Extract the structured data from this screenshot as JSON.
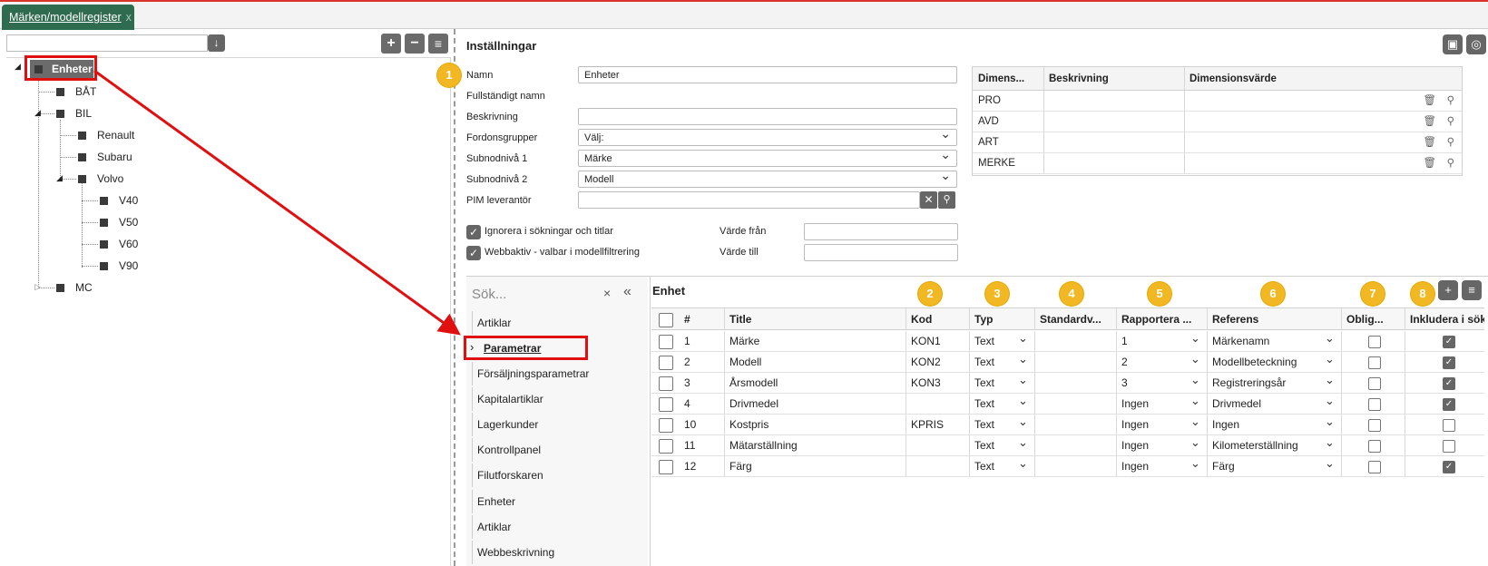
{
  "tab": {
    "label": "Märken/modellregister",
    "close": "x"
  },
  "tree": {
    "search_placeholder": "",
    "root": "Enheter",
    "nodes": [
      "BÅT",
      "BIL",
      "Renault",
      "Subaru",
      "Volvo",
      "V40",
      "V50",
      "V60",
      "V90",
      "MC"
    ]
  },
  "settings": {
    "title": "Inställningar",
    "fields": {
      "namn_label": "Namn",
      "namn_value": "Enheter",
      "fullst_label": "Fullständigt namn",
      "beskr_label": "Beskrivning",
      "beskr_value": "",
      "fordon_label": "Fordonsgrupper",
      "fordon_value": "Välj:",
      "sub1_label": "Subnodnivå 1",
      "sub1_value": "Märke",
      "sub2_label": "Subnodnivå 2",
      "sub2_value": "Modell",
      "pim_label": "PIM leverantör",
      "pim_value": ""
    },
    "checks": {
      "ignore_label": "Ignorera i sökningar och titlar",
      "web_label": "Webbaktiv - valbar i modellfiltrering"
    },
    "range": {
      "from_label": "Värde från",
      "to_label": "Värde till",
      "from_value": "",
      "to_value": ""
    }
  },
  "dim_table": {
    "headers": [
      "Dimens...",
      "Beskrivning",
      "Dimensionsvärde"
    ],
    "rows": [
      "PRO",
      "AVD",
      "ART",
      "MERKE"
    ]
  },
  "side": {
    "search_placeholder": "Sök...",
    "items": [
      "Artiklar",
      "Parametrar",
      "Försäljningsparametrar",
      "Kapitalartiklar",
      "Lagerkunder",
      "Kontrollpanel",
      "Filutforskaren",
      "Enheter",
      "Artiklar",
      "Webbeskrivning"
    ]
  },
  "grid": {
    "title": "Enhet",
    "headers": [
      "#",
      "Title",
      "Kod",
      "Typ",
      "Standardv...",
      "Rapportera ...",
      "Referens",
      "Oblig...",
      "Inkludera i sök..."
    ],
    "rows": [
      {
        "num": "1",
        "title": "Märke",
        "kod": "KON1",
        "typ": "Text",
        "std": "",
        "rapp": "1",
        "ref": "Märkenamn",
        "oblig": false,
        "inkl": true
      },
      {
        "num": "2",
        "title": "Modell",
        "kod": "KON2",
        "typ": "Text",
        "std": "",
        "rapp": "2",
        "ref": "Modellbeteckning",
        "oblig": false,
        "inkl": true
      },
      {
        "num": "3",
        "title": "Årsmodell",
        "kod": "KON3",
        "typ": "Text",
        "std": "",
        "rapp": "3",
        "ref": "Registreringsår",
        "oblig": false,
        "inkl": true
      },
      {
        "num": "4",
        "title": "Drivmedel",
        "kod": "",
        "typ": "Text",
        "std": "",
        "rapp": "Ingen",
        "ref": "Drivmedel",
        "oblig": false,
        "inkl": true
      },
      {
        "num": "10",
        "title": "Kostpris",
        "kod": "KPRIS",
        "typ": "Text",
        "std": "",
        "rapp": "Ingen",
        "ref": "Ingen",
        "oblig": false,
        "inkl": false
      },
      {
        "num": "11",
        "title": "Mätarställning",
        "kod": "",
        "typ": "Text",
        "std": "",
        "rapp": "Ingen",
        "ref": "Kilometerställning",
        "oblig": false,
        "inkl": false
      },
      {
        "num": "12",
        "title": "Färg",
        "kod": "",
        "typ": "Text",
        "std": "",
        "rapp": "Ingen",
        "ref": "Färg",
        "oblig": false,
        "inkl": true
      }
    ]
  },
  "badges": [
    "1",
    "2",
    "3",
    "4",
    "5",
    "6",
    "7",
    "8"
  ],
  "colors": {
    "accent_red": "#e01010",
    "tab_green": "#2f6b4f",
    "badge_yellow": "#f2b824"
  }
}
